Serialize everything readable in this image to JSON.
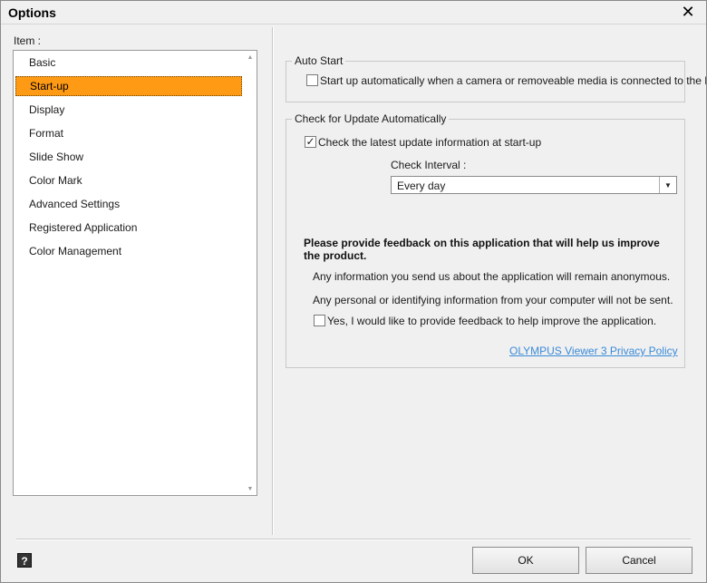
{
  "window": {
    "title": "Options",
    "close_glyph": "✕"
  },
  "sidebar": {
    "label": "Item :",
    "items": [
      {
        "label": "Basic"
      },
      {
        "label": "Start-up",
        "selected": true
      },
      {
        "label": "Display"
      },
      {
        "label": "Format"
      },
      {
        "label": "Slide Show"
      },
      {
        "label": "Color Mark"
      },
      {
        "label": "Advanced Settings"
      },
      {
        "label": "Registered Application"
      },
      {
        "label": "Color Management"
      }
    ],
    "selected_color": "#ff9a14"
  },
  "auto_start": {
    "title": "Auto Start",
    "checkbox_label": "Start up automatically when a camera or removeable media is connected to the PC.",
    "checked": false
  },
  "update": {
    "title": "Check for Update Automatically",
    "checkbox_label": "Check the latest update information at start-up",
    "checked": true,
    "check_mark": "✓",
    "interval_label": "Check Interval :",
    "interval_value": "Every day",
    "dropdown_icon": "▼",
    "feedback_heading": "Please provide feedback on this application that will help us improve the product.",
    "info_1": "Any information you send us about the application will remain anonymous.",
    "info_2": "Any personal or identifying information from your computer will not be sent.",
    "feedback_checkbox_label": "Yes, I would like to provide feedback to help improve the application.",
    "feedback_checked": false,
    "privacy_link": "OLYMPUS Viewer 3 Privacy Policy",
    "link_color": "#3a8ad8"
  },
  "footer": {
    "help_glyph": "?",
    "ok_label": "OK",
    "cancel_label": "Cancel"
  }
}
